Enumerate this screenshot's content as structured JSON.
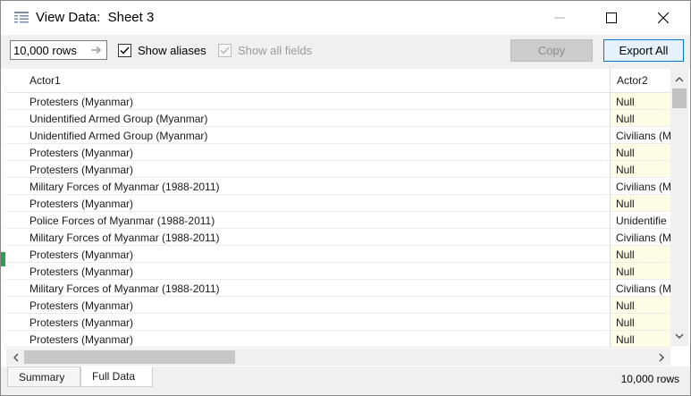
{
  "window": {
    "title": "View Data:  Sheet 3",
    "icon": "table-grid-icon"
  },
  "toolbar": {
    "rows_value": "10,000 rows",
    "show_aliases_label": "Show aliases",
    "show_aliases_checked": true,
    "show_all_fields_label": "Show all fields",
    "show_all_fields_checked": true,
    "show_all_fields_disabled": true,
    "copy_label": "Copy",
    "export_label": "Export All"
  },
  "grid": {
    "columns": [
      "Actor1",
      "Actor2"
    ],
    "rows": [
      [
        "Protesters (Myanmar)",
        "Null"
      ],
      [
        "Unidentified Armed Group (Myanmar)",
        "Null"
      ],
      [
        "Unidentified Armed Group (Myanmar)",
        "Civilians (M"
      ],
      [
        "Protesters (Myanmar)",
        "Null"
      ],
      [
        "Protesters (Myanmar)",
        "Null"
      ],
      [
        "Military Forces of Myanmar (1988-2011)",
        "Civilians (M"
      ],
      [
        "Protesters (Myanmar)",
        "Null"
      ],
      [
        "Police Forces of Myanmar (1988-2011)",
        "Unidentifie"
      ],
      [
        "Military Forces of Myanmar (1988-2011)",
        "Civilians (M"
      ],
      [
        "Protesters (Myanmar)",
        "Null"
      ],
      [
        "Protesters (Myanmar)",
        "Null"
      ],
      [
        "Military Forces of Myanmar (1988-2011)",
        "Civilians (M"
      ],
      [
        "Protesters (Myanmar)",
        "Null"
      ],
      [
        "Protesters (Myanmar)",
        "Null"
      ],
      [
        "Protesters (Myanmar)",
        "Null"
      ]
    ]
  },
  "status": {
    "tabs": [
      "Summary",
      "Full Data"
    ],
    "active_tab": "Full Data",
    "row_count": "10,000 rows"
  },
  "colors": {
    "null_cell_bg": "#fdfde6",
    "accent": "#0078d7"
  }
}
